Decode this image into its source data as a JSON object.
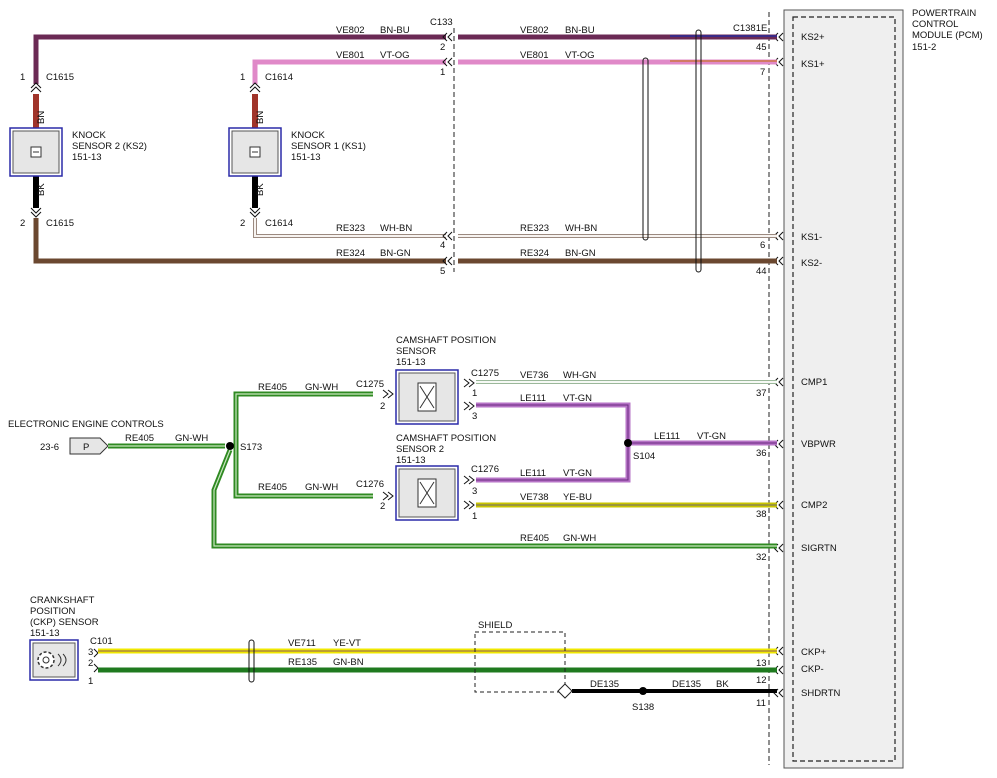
{
  "pcm": {
    "title": [
      "POWERTRAIN",
      "CONTROL",
      "MODULE (PCM)",
      "151-2"
    ],
    "connector": "C1381E",
    "pins": [
      {
        "name": "KS2+",
        "num": "45"
      },
      {
        "name": "KS1+",
        "num": "7"
      },
      {
        "name": "KS1-",
        "num": "6"
      },
      {
        "name": "KS2-",
        "num": "44"
      },
      {
        "name": "CMP1",
        "num": "37"
      },
      {
        "name": "VBPWR",
        "num": "36"
      },
      {
        "name": "CMP2",
        "num": "38"
      },
      {
        "name": "SIGRTN",
        "num": "32"
      },
      {
        "name": "CKP+",
        "num": "13"
      },
      {
        "name": "CKP-",
        "num": "12"
      },
      {
        "name": "SHDRTN",
        "num": "11"
      }
    ]
  },
  "knock_sensor_2": {
    "title": [
      "KNOCK",
      "SENSOR 2 (KS2)",
      "151-13"
    ],
    "connector": "C1615",
    "pin_top": "1",
    "pin_bottom": "2",
    "wire_top": "BN",
    "wire_bottom": "BK"
  },
  "knock_sensor_1": {
    "title": [
      "KNOCK",
      "SENSOR 1 (KS1)",
      "151-13"
    ],
    "connector": "C1614",
    "pin_top": "1",
    "pin_bottom": "2",
    "wire_top": "BN",
    "wire_bottom": "BK"
  },
  "c133": {
    "label": "C133",
    "pins": [
      "2",
      "1",
      "4",
      "5"
    ]
  },
  "knock_wires": [
    {
      "circuit": "VE802",
      "color": "BN-BU"
    },
    {
      "circuit": "VE801",
      "color": "VT-OG"
    },
    {
      "circuit": "RE323",
      "color": "WH-BN"
    },
    {
      "circuit": "RE324",
      "color": "BN-GN"
    }
  ],
  "cmp1": {
    "title": [
      "CAMSHAFT POSITION",
      "SENSOR",
      "151-13"
    ],
    "connector": "C1275",
    "pins": [
      "1",
      "2",
      "3"
    ]
  },
  "cmp2": {
    "title": [
      "CAMSHAFT POSITION",
      "SENSOR 2",
      "151-13"
    ],
    "connector": "C1276",
    "pins": [
      "2",
      "3",
      "1"
    ]
  },
  "eec": {
    "label": "ELECTRONIC ENGINE CONTROLS",
    "ref": "23-6",
    "tag": "P",
    "circuit": "RE405",
    "color": "GN-WH"
  },
  "splices": {
    "s173": "S173",
    "s104": "S104",
    "s138": "S138"
  },
  "cam_wires": {
    "re405_label": "RE405",
    "re405_color": "GN-WH",
    "ve736": "VE736",
    "ve736_color": "WH-GN",
    "le111": "LE111",
    "le111_color": "VT-GN",
    "vt_gn": "VT-GN",
    "ve738": "VE738",
    "ve738_color": "YE-BU"
  },
  "ckp": {
    "title": [
      "CRANKSHAFT",
      "POSITION",
      "(CKP) SENSOR",
      "151-13"
    ],
    "connector": "C101",
    "pins": [
      "3",
      "2",
      "1"
    ]
  },
  "ckp_wires": {
    "ve711": "VE711",
    "ve711_color": "YE-VT",
    "re135": "RE135",
    "re135_color": "GN-BN",
    "de135": "DE135",
    "de135_color": "BK",
    "shield": "SHIELD"
  },
  "colors": {
    "bn_bu": "#6b2a55",
    "vt_og": "#e089c8",
    "wh_bn": "#c9b8ad",
    "bn_gn": "#6b4830",
    "bn": "#a0342a",
    "bk": "#000000",
    "gn_wh": "#2f8a22",
    "gn_wh_light": "#c9e6c0",
    "wh_gn": "#dfe8dc",
    "vt_gn": "#b673c6",
    "ye_bu": "#c9c400",
    "ye_vt": "#f0e800",
    "gn_bn": "#1f7a1f",
    "module_fill": "#efefef",
    "connector_border": "#2b2ba8"
  }
}
